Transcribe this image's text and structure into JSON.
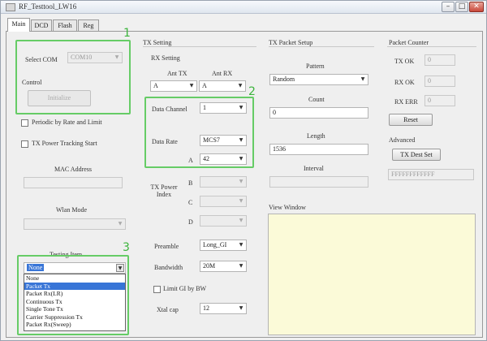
{
  "window": {
    "title": "RF_Testtool_LW16",
    "minimize": "–",
    "maximize": "□",
    "close": "✕",
    "icon": "app-icon"
  },
  "tabs": [
    {
      "label": "Main",
      "active": true
    },
    {
      "label": "DCD",
      "active": false
    },
    {
      "label": "Flash",
      "active": false
    },
    {
      "label": "Reg",
      "active": false
    }
  ],
  "left": {
    "select_com_label": "Select COM",
    "select_com_value": "COM10",
    "control_label": "Control",
    "initialize_button": "Initialize",
    "periodic_label": "Periodic by Rate and Limit",
    "tx_power_label": "TX Power Tracking Start",
    "mac_label": "MAC Address",
    "mac_value": "",
    "wlan_mode_label": "Wlan Mode",
    "wlan_mode_value": "",
    "testing_item_label": "Testing Item",
    "testing_item_value": "None",
    "testing_items": [
      "None",
      "Packet Tx",
      "Packet Rx(LR)",
      "Continuous Tx",
      "Single Tone Tx",
      "Carrier Suppression Tx",
      "Packet Rx(Sweep)"
    ],
    "testing_item_selected_index": 1
  },
  "tx_setting": {
    "title": "TX Setting",
    "rx_setting": "RX Setting",
    "ant_tx_label": "Ant TX",
    "ant_rx_label": "Ant RX",
    "ant_tx_value": "A",
    "ant_rx_value": "A",
    "data_channel_label": "Data Channel",
    "data_channel_value": "1",
    "data_rate_label": "Data Rate",
    "data_rate_value": "MCS7",
    "a_label": "A",
    "a_value": "42",
    "tx_power_index_label": "TX Power\nIndex",
    "b_label": "B",
    "c_label": "C",
    "d_label": "D",
    "preamble_label": "Preamble",
    "preamble_value": "Long_GI",
    "bandwidth_label": "Bandwidth",
    "bandwidth_value": "20M",
    "limit_label": "Limit GI by BW",
    "xtal_label": "Xtal cap",
    "xtal_value": "12"
  },
  "tx_packet": {
    "title": "TX Packet Setup",
    "pattern_label": "Pattern",
    "pattern_value": "Random",
    "count_label": "Count",
    "count_value": "0",
    "length_label": "Length",
    "length_value": "1536",
    "interval_label": "Interval",
    "interval_value": ""
  },
  "counter": {
    "title": "Packet Counter",
    "tx_ok_label": "TX OK",
    "tx_ok_value": "0",
    "rx_ok_label": "RX OK",
    "rx_ok_value": "0",
    "rx_err_label": "RX ERR",
    "rx_err_value": "0",
    "reset_button": "Reset",
    "advanced_label": "Advanced",
    "tx_dest_button": "TX Dest Set",
    "dest_value": "FFFFFFFFFFFF"
  },
  "view_window_label": "View Window",
  "callouts": [
    "1",
    "2",
    "3"
  ],
  "colors": {
    "highlight": "#66cc66",
    "view_bg": "#fbfad8",
    "selection": "#3875d7"
  }
}
